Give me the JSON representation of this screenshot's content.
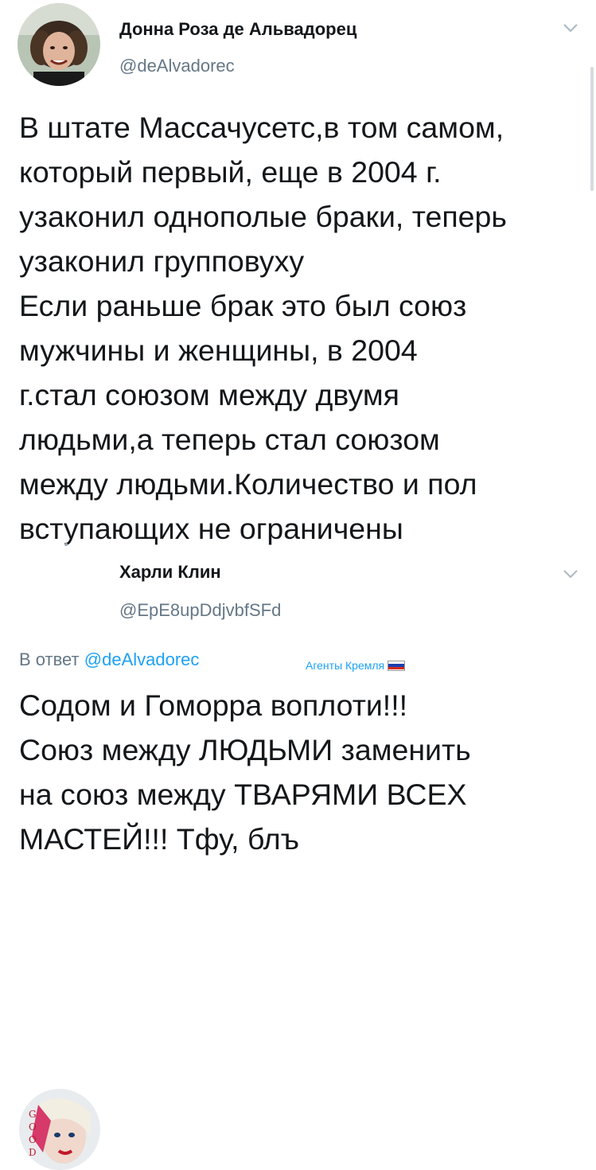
{
  "tweet1": {
    "author_name": "Донна Роза де Альвадорец",
    "handle": "@deAlvadorec",
    "text": "В штате Массачусетс,в том самом,\nкоторый первый, еще в 2004 г.\nузаконил однополые браки, теперь\nузаконил групповуху\nЕсли раньше брак это был союз\nмужчины и женщины, в 2004\nг.стал союзом между двумя\nлюдьми,а теперь стал союзом\nмежду людьми.Количество и пол\nвступающих не ограничены",
    "menu_icon": "chevron-down-icon"
  },
  "tweet2": {
    "author_name": "Харли Клин",
    "handle": "@EpE8upDdjvbfSFd",
    "reply_prefix": "В ответ",
    "reply_handle": "@deAlvadorec",
    "badge_text": "Агенты Кремля",
    "badge_icon": "russian-flag-icon",
    "text": "Содом и Гоморра воплоти!!!\nСоюз между ЛЮДЬМИ заменить\nна союз между ТВАРЯМИ ВСЕХ\nМАСТЕЙ!!! Тфу, блъ",
    "menu_icon": "chevron-down-icon"
  },
  "colors": {
    "text": "#14171a",
    "secondary": "#657786",
    "link": "#1da1f2"
  }
}
